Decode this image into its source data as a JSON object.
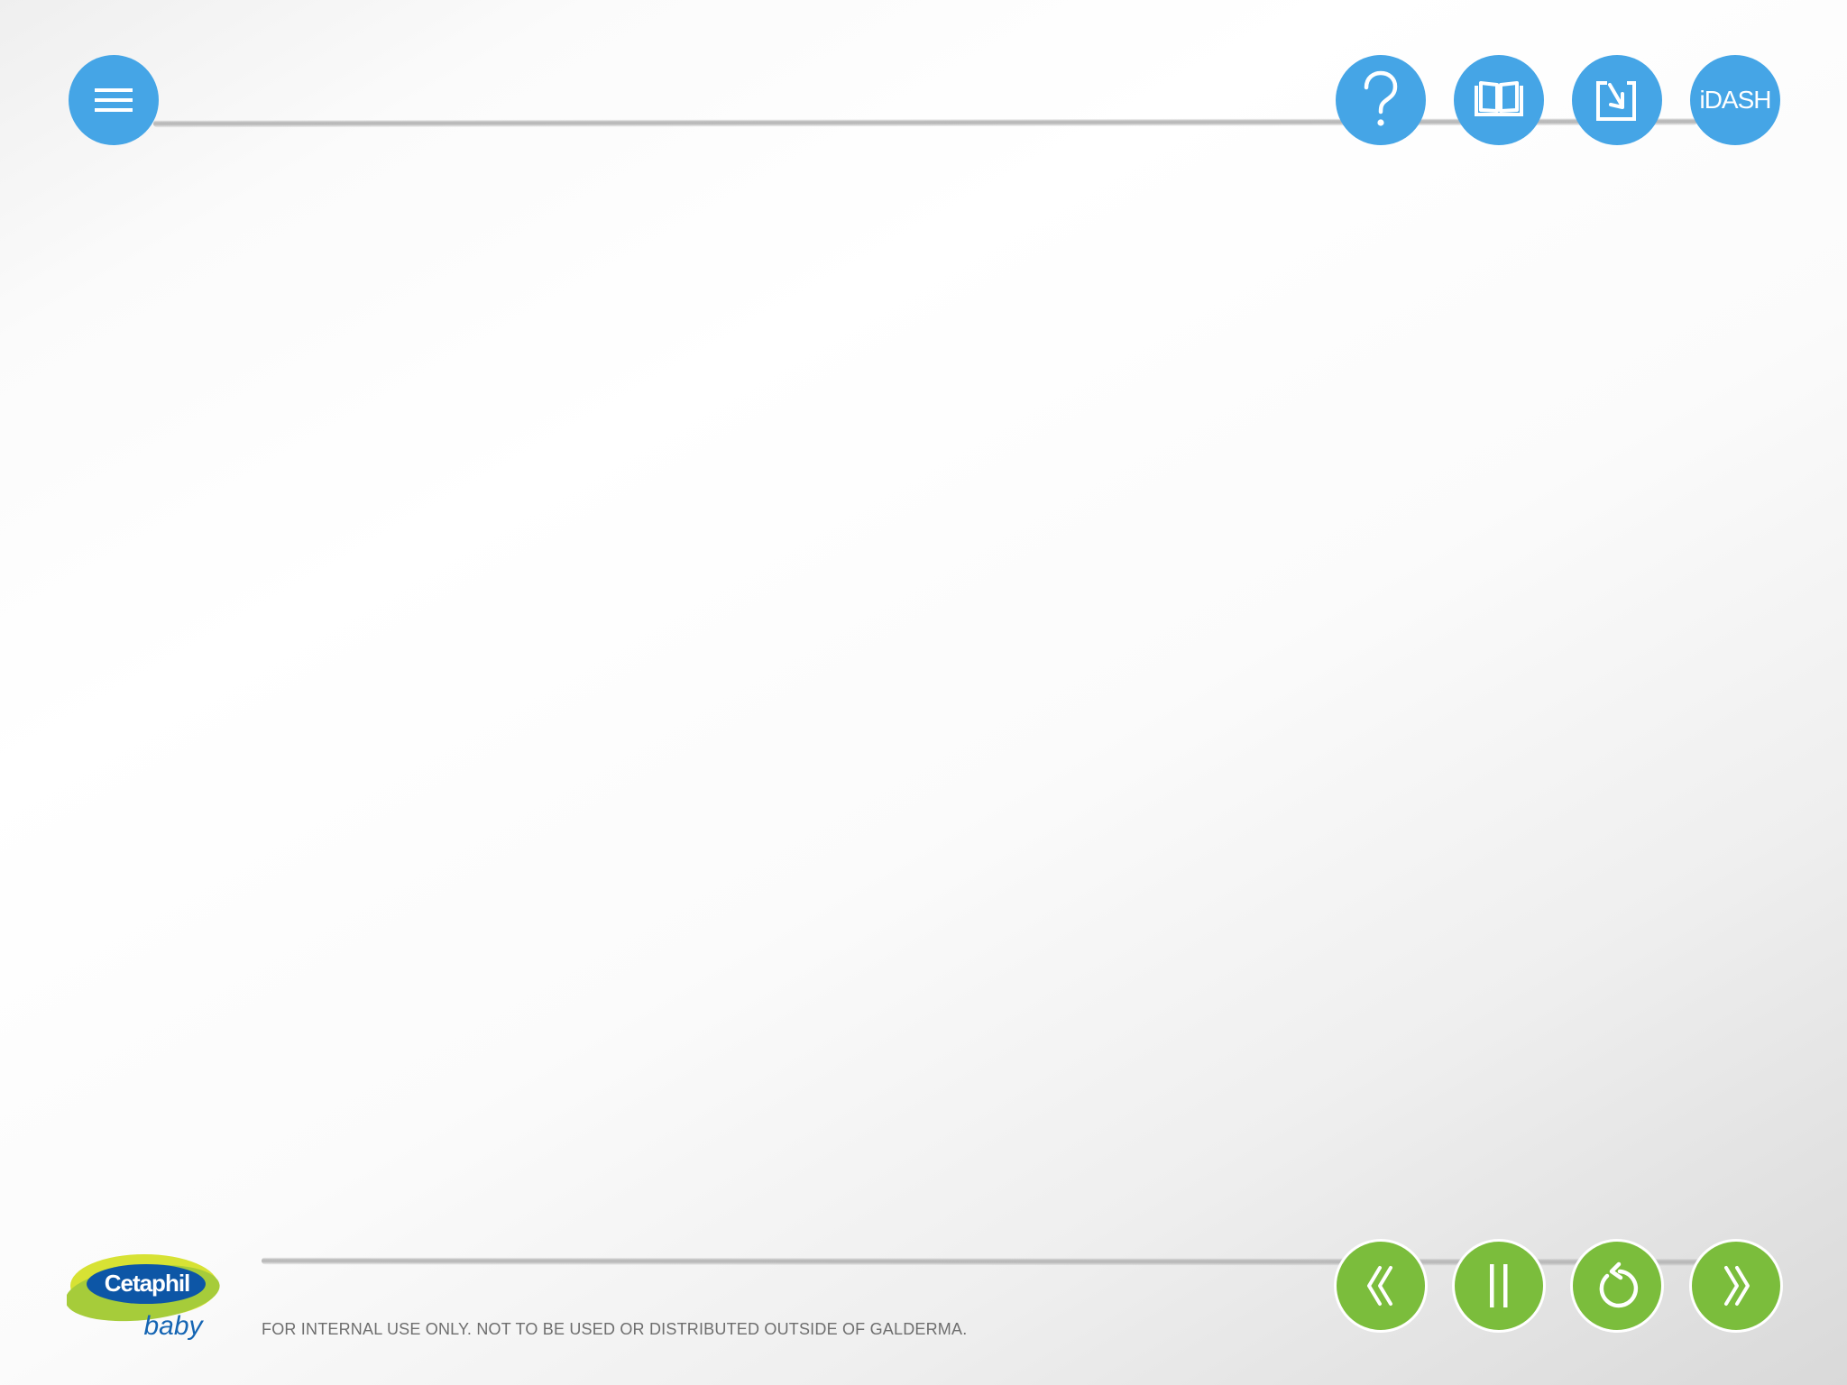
{
  "header": {
    "menu_button": {
      "icon": "hamburger-menu-icon"
    },
    "actions": [
      {
        "id": "help",
        "icon": "question-mark-icon"
      },
      {
        "id": "library",
        "icon": "open-book-icon"
      },
      {
        "id": "download",
        "icon": "download-arrow-icon"
      },
      {
        "id": "idash",
        "label": "iDASH"
      }
    ]
  },
  "footer": {
    "logo": {
      "brand": "Cetaphil",
      "sub": "baby"
    },
    "disclaimer": "FOR INTERNAL USE ONLY. NOT TO BE USED OR DISTRIBUTED OUTSIDE OF GALDERMA.",
    "controls": [
      {
        "id": "previous",
        "icon": "double-chevron-left-icon"
      },
      {
        "id": "pause",
        "icon": "pause-icon"
      },
      {
        "id": "replay",
        "icon": "replay-icon"
      },
      {
        "id": "next",
        "icon": "double-chevron-right-icon"
      }
    ]
  },
  "colors": {
    "header_button": "#45a5e6",
    "footer_button": "#7bbd3c",
    "logo_navy": "#0d56a6",
    "logo_green": "#a6cc3a",
    "logo_yellow": "#d7e234"
  }
}
